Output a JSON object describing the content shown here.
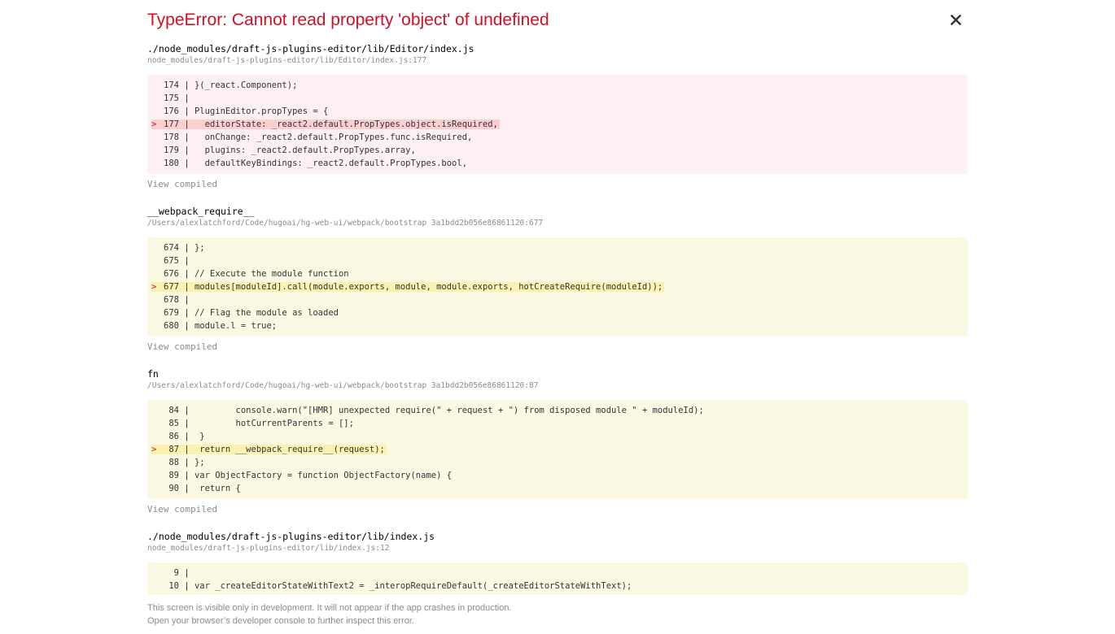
{
  "error": {
    "title": "TypeError: Cannot read property 'object' of undefined",
    "title_color": "#ce1126"
  },
  "close_icon": "close-icon",
  "view_compiled_label": "View compiled",
  "frames": [
    {
      "function_name": "./node_modules/draft-js-plugins-editor/lib/Editor/index.js",
      "location": "node_modules/draft-js-plugins-editor/lib/Editor/index.js:177",
      "style": "red",
      "lines": [
        {
          "marker": "",
          "num": "174",
          "code": "}(_react.Component);"
        },
        {
          "marker": "",
          "num": "175",
          "code": ""
        },
        {
          "marker": "",
          "num": "176",
          "code": "PluginEditor.propTypes = {"
        },
        {
          "marker": ">",
          "num": "177",
          "code": "  editorState: _react2.default.PropTypes.object.isRequired,"
        },
        {
          "marker": "",
          "num": "178",
          "code": "  onChange: _react2.default.PropTypes.func.isRequired,"
        },
        {
          "marker": "",
          "num": "179",
          "code": "  plugins: _react2.default.PropTypes.array,"
        },
        {
          "marker": "",
          "num": "180",
          "code": "  defaultKeyBindings: _react2.default.PropTypes.bool,"
        }
      ]
    },
    {
      "function_name": "__webpack_require__",
      "location": "/Users/alexlatchford/Code/hugoai/hg-web-ui/webpack/bootstrap 3a1bdd2b056e86861120:677",
      "style": "yellow",
      "lines": [
        {
          "marker": "",
          "num": "674",
          "code": "};"
        },
        {
          "marker": "",
          "num": "675",
          "code": ""
        },
        {
          "marker": "",
          "num": "676",
          "code": "// Execute the module function"
        },
        {
          "marker": ">",
          "num": "677",
          "code": "modules[moduleId].call(module.exports, module, module.exports, hotCreateRequire(moduleId));"
        },
        {
          "marker": "",
          "num": "678",
          "code": ""
        },
        {
          "marker": "",
          "num": "679",
          "code": "// Flag the module as loaded"
        },
        {
          "marker": "",
          "num": "680",
          "code": "module.l = true;"
        }
      ]
    },
    {
      "function_name": "fn",
      "location": "/Users/alexlatchford/Code/hugoai/hg-web-ui/webpack/bootstrap 3a1bdd2b056e86861120:87",
      "style": "yellow",
      "lines": [
        {
          "marker": "",
          "num": "84",
          "code": "        console.warn(\"[HMR] unexpected require(\" + request + \") from disposed module \" + moduleId);"
        },
        {
          "marker": "",
          "num": "85",
          "code": "        hotCurrentParents = [];"
        },
        {
          "marker": "",
          "num": "86",
          "code": " }"
        },
        {
          "marker": ">",
          "num": "87",
          "code": " return __webpack_require__(request);"
        },
        {
          "marker": "",
          "num": "88",
          "code": "};"
        },
        {
          "marker": "",
          "num": "89",
          "code": "var ObjectFactory = function ObjectFactory(name) {"
        },
        {
          "marker": "",
          "num": "90",
          "code": " return {"
        }
      ]
    },
    {
      "function_name": "./node_modules/draft-js-plugins-editor/lib/index.js",
      "location": "node_modules/draft-js-plugins-editor/lib/index.js:12",
      "style": "yellow",
      "lines": [
        {
          "marker": "",
          "num": "9",
          "code": ""
        },
        {
          "marker": "",
          "num": "10",
          "code": "var _createEditorStateWithText2 = _interopRequireDefault(_createEditorStateWithText);"
        }
      ]
    }
  ],
  "footer": {
    "line1": "This screen is visible only in development. It will not appear if the app crashes in production.",
    "line2": "Open your browser’s developer console to further inspect this error."
  }
}
